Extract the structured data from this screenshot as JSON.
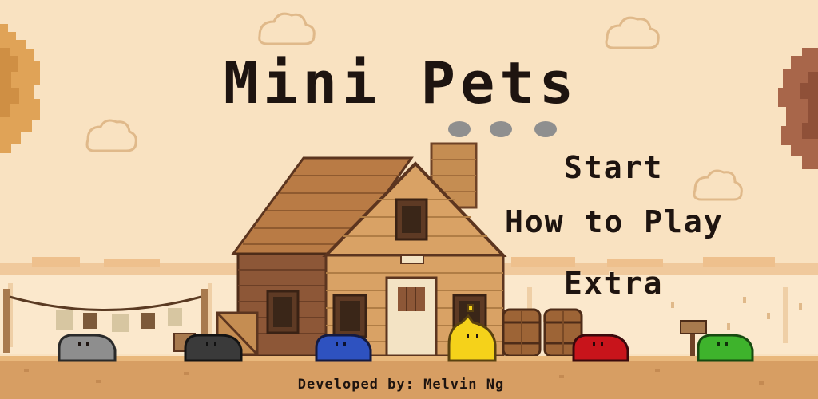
{
  "title": "Mini Pets",
  "menu": {
    "start_label": "Start",
    "how_to_play_label": "How to Play",
    "extra_label": "Extra"
  },
  "credit": "Developed by: Melvin Ng",
  "colors": {
    "sky": "#f9e2c1",
    "ground": "#d79e63",
    "text": "#1e1410",
    "slime_gray": "#8e8e8e",
    "slime_black": "#3a3a3a",
    "slime_blue": "#2e52c0",
    "slime_yellow": "#f5d21a",
    "slime_red": "#c8141b",
    "slime_green": "#3eb32c"
  },
  "icons": [
    "house-icon",
    "barrel-icon",
    "cloud-icon",
    "tree-icon",
    "mailbox-icon",
    "clothesline-icon",
    "slime-icon"
  ]
}
